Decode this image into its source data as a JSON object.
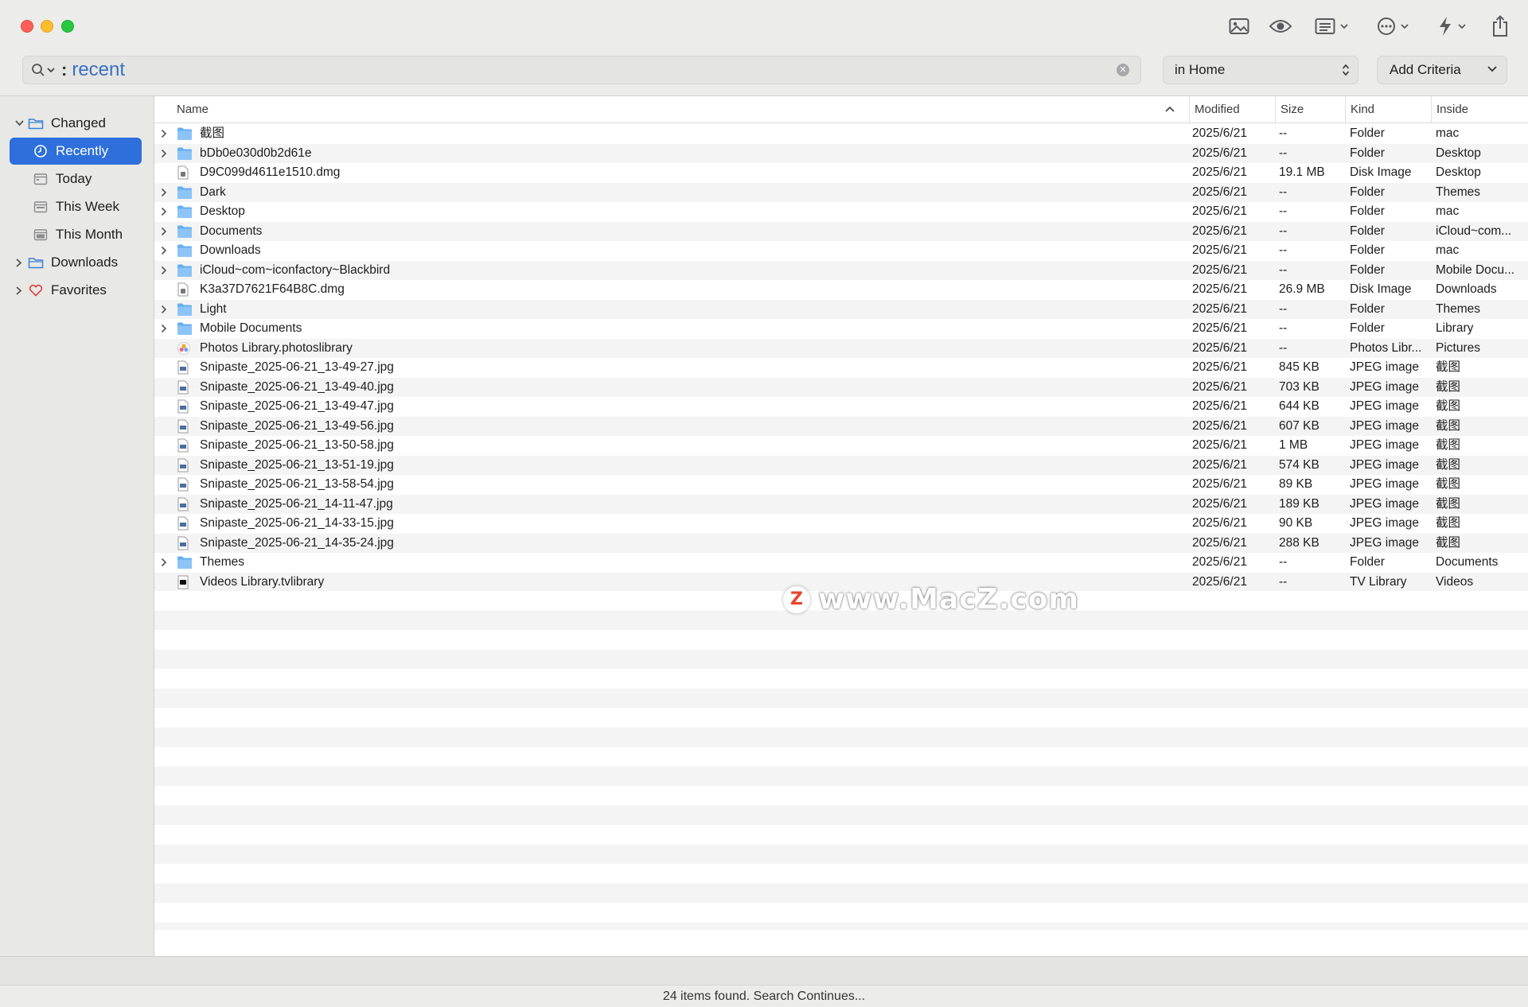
{
  "window": {
    "toolbar_icons": [
      "image-icon",
      "eye-icon",
      "list-view-icon",
      "more-icon",
      "bolt-icon",
      "share-icon"
    ]
  },
  "search": {
    "query": "recent",
    "colon": ":"
  },
  "scope": {
    "label": "in Home"
  },
  "criteria": {
    "label": "Add Criteria"
  },
  "sidebar": {
    "items": [
      {
        "label": "Changed",
        "icon": "folder-icon",
        "expanded": true
      },
      {
        "label": "Recently",
        "icon": "clock-icon",
        "selected": true
      },
      {
        "label": "Today",
        "icon": "calendar-icon"
      },
      {
        "label": "This Week",
        "icon": "calendar-icon"
      },
      {
        "label": "This Month",
        "icon": "calendar-icon"
      },
      {
        "label": "Downloads",
        "icon": "folder-icon",
        "expanded": false
      },
      {
        "label": "Favorites",
        "icon": "heart-icon",
        "expanded": false
      }
    ]
  },
  "table": {
    "columns": {
      "name": "Name",
      "modified": "Modified",
      "size": "Size",
      "kind": "Kind",
      "inside": "Inside"
    },
    "rows": [
      {
        "name": "截图",
        "modified": "2025/6/21",
        "size": "--",
        "kind": "Folder",
        "inside": "mac",
        "icon": "folder"
      },
      {
        "name": "bDb0e030d0b2d61e",
        "modified": "2025/6/21",
        "size": "--",
        "kind": "Folder",
        "inside": "Desktop",
        "icon": "folder"
      },
      {
        "name": "D9C099d4611e1510.dmg",
        "modified": "2025/6/21",
        "size": "19.1 MB",
        "kind": "Disk Image",
        "inside": "Desktop",
        "icon": "file"
      },
      {
        "name": "Dark",
        "modified": "2025/6/21",
        "size": "--",
        "kind": "Folder",
        "inside": "Themes",
        "icon": "folder"
      },
      {
        "name": "Desktop",
        "modified": "2025/6/21",
        "size": "--",
        "kind": "Folder",
        "inside": "mac",
        "icon": "folder"
      },
      {
        "name": "Documents",
        "modified": "2025/6/21",
        "size": "--",
        "kind": "Folder",
        "inside": "iCloud~com...",
        "icon": "folder"
      },
      {
        "name": "Downloads",
        "modified": "2025/6/21",
        "size": "--",
        "kind": "Folder",
        "inside": "mac",
        "icon": "folder"
      },
      {
        "name": "iCloud~com~iconfactory~Blackbird",
        "modified": "2025/6/21",
        "size": "--",
        "kind": "Folder",
        "inside": "Mobile Docu...",
        "icon": "folder"
      },
      {
        "name": "K3a37D7621F64B8C.dmg",
        "modified": "2025/6/21",
        "size": "26.9 MB",
        "kind": "Disk Image",
        "inside": "Downloads",
        "icon": "file"
      },
      {
        "name": "Light",
        "modified": "2025/6/21",
        "size": "--",
        "kind": "Folder",
        "inside": "Themes",
        "icon": "folder"
      },
      {
        "name": "Mobile Documents",
        "modified": "2025/6/21",
        "size": "--",
        "kind": "Folder",
        "inside": "Library",
        "icon": "folder"
      },
      {
        "name": "Photos Library.photoslibrary",
        "modified": "2025/6/21",
        "size": "--",
        "kind": "Photos Libr...",
        "inside": "Pictures",
        "icon": "photos"
      },
      {
        "name": "Snipaste_2025-06-21_13-49-27.jpg",
        "modified": "2025/6/21",
        "size": "845 KB",
        "kind": "JPEG image",
        "inside": "截图",
        "icon": "image"
      },
      {
        "name": "Snipaste_2025-06-21_13-49-40.jpg",
        "modified": "2025/6/21",
        "size": "703 KB",
        "kind": "JPEG image",
        "inside": "截图",
        "icon": "image"
      },
      {
        "name": "Snipaste_2025-06-21_13-49-47.jpg",
        "modified": "2025/6/21",
        "size": "644 KB",
        "kind": "JPEG image",
        "inside": "截图",
        "icon": "image"
      },
      {
        "name": "Snipaste_2025-06-21_13-49-56.jpg",
        "modified": "2025/6/21",
        "size": "607 KB",
        "kind": "JPEG image",
        "inside": "截图",
        "icon": "image"
      },
      {
        "name": "Snipaste_2025-06-21_13-50-58.jpg",
        "modified": "2025/6/21",
        "size": "1 MB",
        "kind": "JPEG image",
        "inside": "截图",
        "icon": "image"
      },
      {
        "name": "Snipaste_2025-06-21_13-51-19.jpg",
        "modified": "2025/6/21",
        "size": "574 KB",
        "kind": "JPEG image",
        "inside": "截图",
        "icon": "image"
      },
      {
        "name": "Snipaste_2025-06-21_13-58-54.jpg",
        "modified": "2025/6/21",
        "size": "89 KB",
        "kind": "JPEG image",
        "inside": "截图",
        "icon": "image"
      },
      {
        "name": "Snipaste_2025-06-21_14-11-47.jpg",
        "modified": "2025/6/21",
        "size": "189 KB",
        "kind": "JPEG image",
        "inside": "截图",
        "icon": "image"
      },
      {
        "name": "Snipaste_2025-06-21_14-33-15.jpg",
        "modified": "2025/6/21",
        "size": "90 KB",
        "kind": "JPEG image",
        "inside": "截图",
        "icon": "image"
      },
      {
        "name": "Snipaste_2025-06-21_14-35-24.jpg",
        "modified": "2025/6/21",
        "size": "288 KB",
        "kind": "JPEG image",
        "inside": "截图",
        "icon": "image"
      },
      {
        "name": "Themes",
        "modified": "2025/6/21",
        "size": "--",
        "kind": "Folder",
        "inside": "Documents",
        "icon": "folder"
      },
      {
        "name": "Videos Library.tvlibrary",
        "modified": "2025/6/21",
        "size": "--",
        "kind": "TV Library",
        "inside": "Videos",
        "icon": "tv"
      }
    ]
  },
  "watermark": {
    "badge": "Z",
    "text": "www.MacZ.com"
  },
  "status": {
    "text": "24 items found. Search Continues..."
  },
  "colors": {
    "accent": "#2e6fdc",
    "folder": "#5aa9f0",
    "query": "#3a6fc2"
  }
}
